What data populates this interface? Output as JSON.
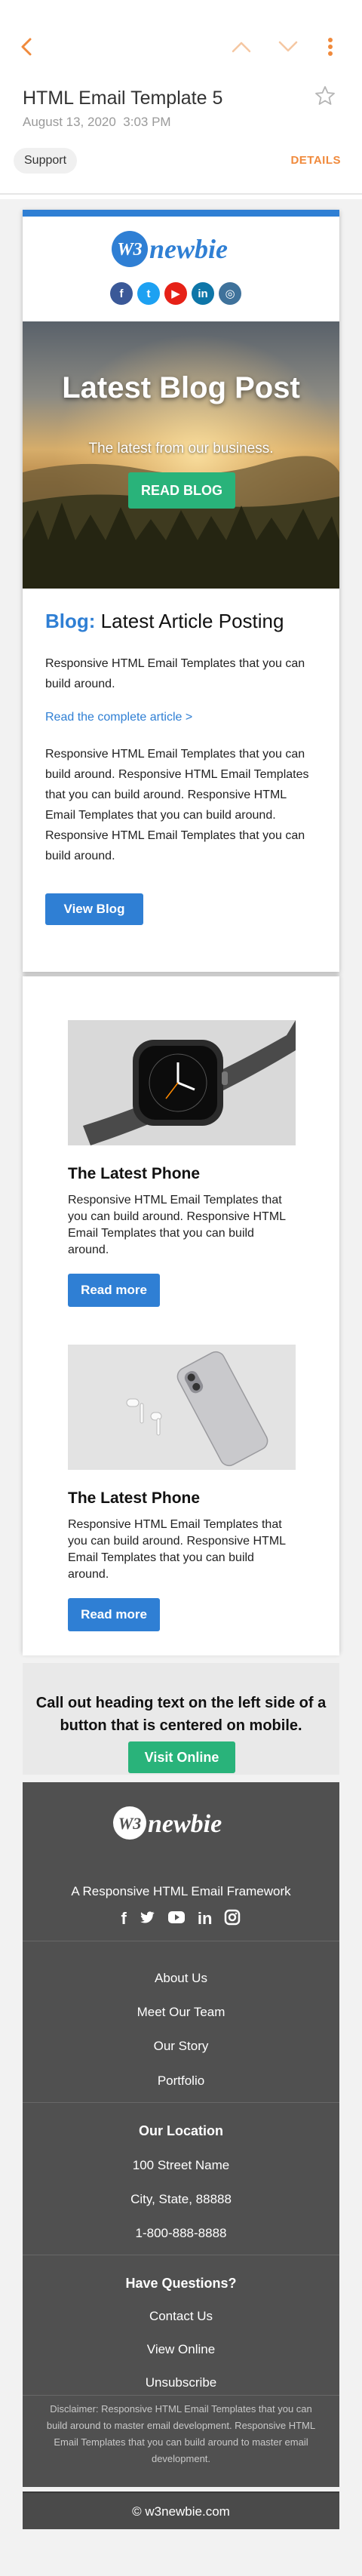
{
  "app": {
    "subject": "HTML Email Template 5",
    "date": "August 13, 2020",
    "time": "3:03 PM",
    "label_chip": "Support",
    "details_label": "DETAILS",
    "accent": "#f08a3c"
  },
  "brand": {
    "logo_badge": "W3",
    "logo_text": "newbie"
  },
  "social_icons": [
    {
      "name": "facebook-icon",
      "glyph": "f",
      "color": "#3b5998"
    },
    {
      "name": "twitter-icon",
      "glyph": "t",
      "color": "#1da1f2"
    },
    {
      "name": "youtube-icon",
      "glyph": "▶",
      "color": "#e62117"
    },
    {
      "name": "linkedin-icon",
      "glyph": "in",
      "color": "#0e76a8"
    },
    {
      "name": "instagram-icon",
      "glyph": "◎",
      "color": "#3f729b"
    }
  ],
  "hero": {
    "title": "Latest Blog Post",
    "subtitle": "The latest from our business.",
    "button": "READ BLOG"
  },
  "blog": {
    "keyword": "Blog:",
    "heading": "Latest Article Posting",
    "intro": "Responsive HTML Email Templates that you can build around.",
    "read_link": "Read the complete article >",
    "body": "Responsive HTML Email Templates that you can build around. Responsive HTML Email Templates that you can build around. Responsive HTML Email Templates that you can build around. Responsive HTML Email Templates that you can build around.",
    "button": "View Blog"
  },
  "products": [
    {
      "title": "The Latest Phone",
      "text": "Responsive HTML Email Templates that you can build around. Responsive HTML Email Templates that you can build around.",
      "button": "Read more"
    },
    {
      "title": "The Latest Phone",
      "text": "Responsive HTML Email Templates that you can build around. Responsive HTML Email Templates that you can build around.",
      "button": "Read more"
    }
  ],
  "callout": {
    "text": "Call out heading text on the left side of a button that is centered on mobile.",
    "button": "Visit Online"
  },
  "footer": {
    "tagline": "A Responsive HTML Email Framework",
    "links": [
      "About Us",
      "Meet Our Team",
      "Our Story",
      "Portfolio"
    ],
    "location_heading": "Our Location",
    "address": [
      "100 Street Name",
      "City, State, 88888",
      "1-800-888-8888"
    ],
    "questions_heading": "Have Questions?",
    "question_links": [
      "Contact Us",
      "View Online",
      "Unsubscribe"
    ],
    "disclaimer": "Disclaimer: Responsive HTML Email Templates that you can build around to master email development. Responsive HTML Email Templates that you can build around to master email development.",
    "copyright": "© w3newbie.com"
  }
}
